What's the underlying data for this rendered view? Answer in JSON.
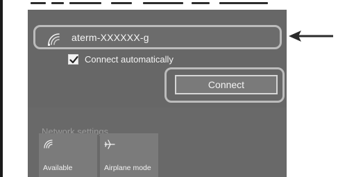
{
  "network": {
    "ssid": "aterm-XXXXXX-g",
    "connect_automatically_label": "Connect automatically",
    "connect_automatically_checked": true,
    "connect_button_label": "Connect"
  },
  "settings": {
    "label": "Network settings"
  },
  "quick_actions": [
    {
      "label": "Available",
      "icon": "wifi-icon"
    },
    {
      "label": "Airplane mode",
      "icon": "airplane-icon"
    }
  ],
  "colors": {
    "panel_bg": "#676767",
    "highlight_ring": "#bcbcbc",
    "text": "#f4f4f4",
    "muted_text": "#9a9a9a"
  }
}
